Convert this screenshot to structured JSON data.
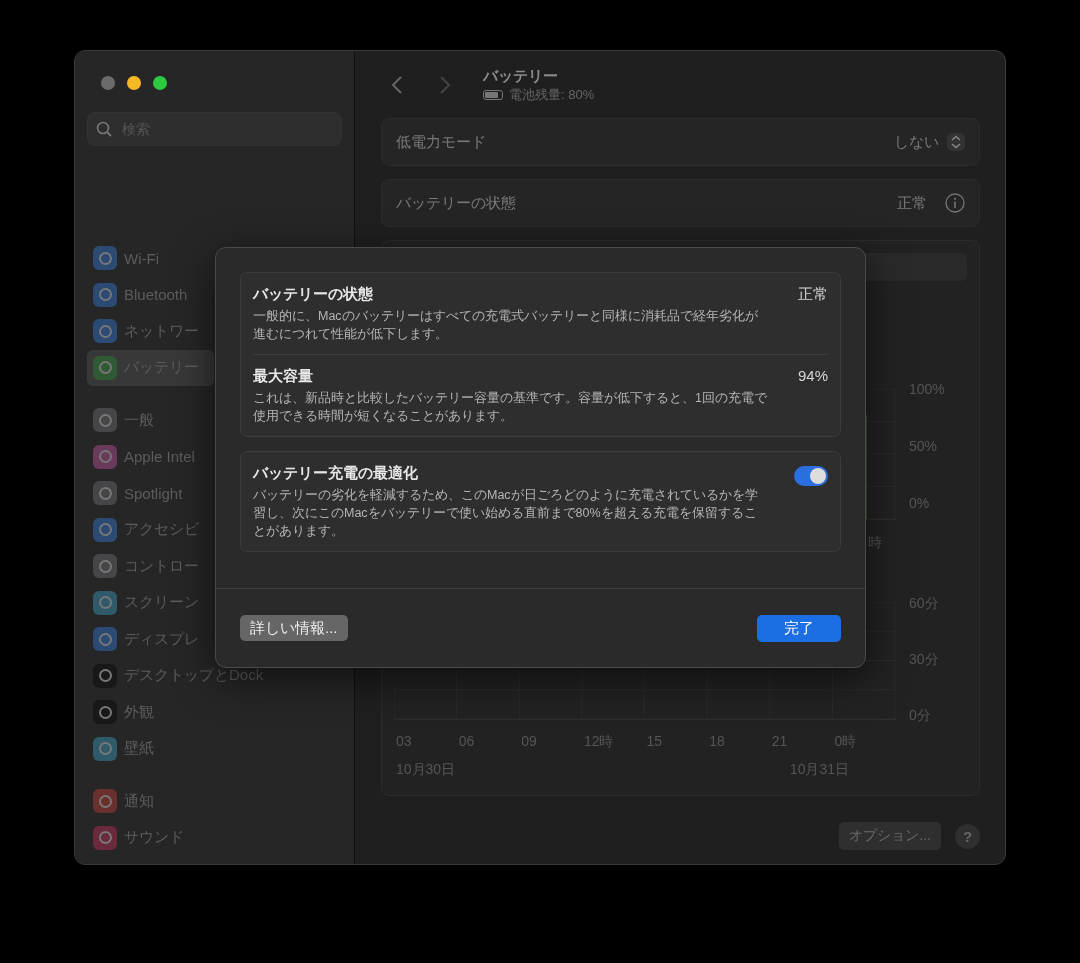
{
  "window": {
    "traffic_lights": [
      {
        "color": "#6b6b6b"
      },
      {
        "color": "#f5b928"
      },
      {
        "color": "#2ec841"
      }
    ]
  },
  "sidebar": {
    "search": {
      "placeholder": "検索"
    },
    "groups": [
      [
        {
          "label": "Wi-Fi",
          "color": "#2b4a74",
          "selected": false
        },
        {
          "label": "Bluetooth",
          "color": "#2b4a74",
          "selected": false
        },
        {
          "label": "ネットワー",
          "color": "#2b4a74",
          "selected": false
        },
        {
          "label": "バッテリー",
          "color": "#2f5a34",
          "selected": true
        }
      ],
      [
        {
          "label": "一般",
          "color": "#464648",
          "selected": false
        },
        {
          "label": "Apple Intel",
          "color": "#6a3a5a",
          "selected": false
        },
        {
          "label": "Spotlight",
          "color": "#464648",
          "selected": false
        },
        {
          "label": "アクセシビ",
          "color": "#2b4a74",
          "selected": false
        },
        {
          "label": "コントロー",
          "color": "#464648",
          "selected": false
        },
        {
          "label": "スクリーン",
          "color": "#2f5a6a",
          "selected": false
        },
        {
          "label": "ディスプレ",
          "color": "#2b4a74",
          "selected": false
        },
        {
          "label": "デスクトップとDock",
          "color": "#181818",
          "selected": false
        },
        {
          "label": "外観",
          "color": "#181818",
          "selected": false
        },
        {
          "label": "壁紙",
          "color": "#2f5a6a",
          "selected": false
        }
      ],
      [
        {
          "label": "通知",
          "color": "#6a302c",
          "selected": false
        },
        {
          "label": "サウンド",
          "color": "#6a2a3c",
          "selected": false
        }
      ]
    ]
  },
  "header": {
    "title": "バッテリー",
    "subtitle": "電池残量: 80%"
  },
  "rows": [
    {
      "kind": "popup",
      "label": "低電力モード",
      "value": "しない"
    },
    {
      "kind": "info",
      "label": "バッテリーの状態",
      "value": "正常"
    }
  ],
  "usage_panel": {
    "level_ticks": [
      "100%",
      "50%",
      "0%"
    ],
    "level_hour_fragment": "時",
    "time_ticks": [
      "60分",
      "30分",
      "0分"
    ],
    "hours": [
      "03",
      "06",
      "09",
      "12時",
      "15",
      "18",
      "21",
      "0時"
    ],
    "dates": [
      "10月30日",
      "10月31日"
    ]
  },
  "footer": {
    "options_button": "オプション...",
    "help_button": "?"
  },
  "dialog": {
    "cards": [
      {
        "items": [
          {
            "title": "バッテリーの状態",
            "value": "正常",
            "description": "一般的に、Macのバッテリーはすべての充電式バッテリーと同様に消耗品で経年劣化が進むにつれて性能が低下します。"
          },
          {
            "title": "最大容量",
            "value": "94%",
            "description": "これは、新品時と比較したバッテリー容量の基準です。容量が低下すると、1回の充電で使用できる時間が短くなることがあります。"
          }
        ]
      },
      {
        "items": [
          {
            "title": "バッテリー充電の最適化",
            "on": true,
            "description": "バッテリーの劣化を軽減するため、このMacが日ごろどのように充電されているかを学習し、次にこのMacをバッテリーで使い始める直前まで80%を超える充電を保留することがあります。"
          }
        ]
      }
    ],
    "more_info_button": "詳しい情報...",
    "done_button": "完了"
  }
}
